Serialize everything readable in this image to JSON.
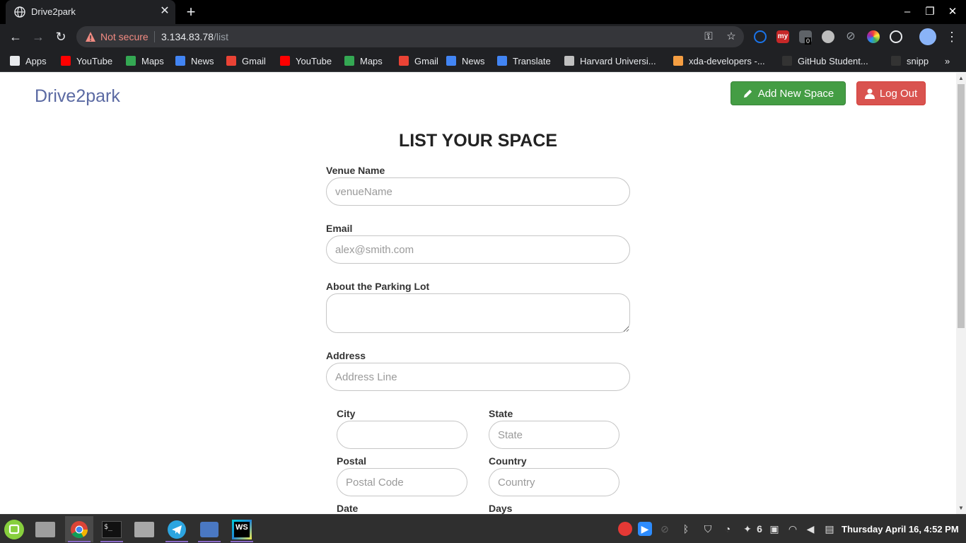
{
  "browser": {
    "tab_title": "Drive2park",
    "security_label": "Not secure",
    "url_host": "3.134.83.78",
    "url_path": "/list",
    "extension_badge": "0"
  },
  "bookmarks": [
    {
      "label": "Apps",
      "icon": "apps-grid-icon",
      "color": "#e8eaed"
    },
    {
      "label": "YouTube",
      "icon": "youtube-icon",
      "color": "#ff0000"
    },
    {
      "label": "Maps",
      "icon": "maps-icon",
      "color": "#34a853"
    },
    {
      "label": "News",
      "icon": "google-news-icon",
      "color": "#4285f4"
    },
    {
      "label": "Gmail",
      "icon": "gmail-icon",
      "color": "#ea4335"
    },
    {
      "label": "YouTube",
      "icon": "youtube-icon",
      "color": "#ff0000"
    },
    {
      "label": "Maps",
      "icon": "maps-icon",
      "color": "#34a853"
    },
    {
      "label": "Gmail",
      "icon": "gmail-icon",
      "color": "#ea4335"
    },
    {
      "label": "News",
      "icon": "google-news-icon",
      "color": "#4285f4"
    },
    {
      "label": "Translate",
      "icon": "translate-icon",
      "color": "#4285f4"
    },
    {
      "label": "Harvard Universi...",
      "icon": "edx-icon",
      "color": "#c0c0c0"
    },
    {
      "label": "xda-developers -...",
      "icon": "xda-icon",
      "color": "#f59e42"
    },
    {
      "label": "GitHub Student...",
      "icon": "github-icon",
      "color": "#333333"
    },
    {
      "label": "snipp",
      "icon": "github-icon",
      "color": "#333333"
    }
  ],
  "site": {
    "brand": "Drive2park",
    "add_button": "Add New Space",
    "logout_button": "Log Out",
    "heading": "LIST YOUR SPACE"
  },
  "form": {
    "venue_label": "Venue Name",
    "venue_placeholder": "venueName",
    "email_label": "Email",
    "email_placeholder": "alex@smith.com",
    "about_label": "About the Parking Lot",
    "about_placeholder": "",
    "address_label": "Address",
    "address_placeholder": "Address Line",
    "city_label": "City",
    "city_placeholder": "",
    "state_label": "State",
    "state_placeholder": "State",
    "postal_label": "Postal",
    "postal_placeholder": "Postal Code",
    "country_label": "Country",
    "country_placeholder": "Country",
    "date_label": "Date",
    "days_label": "Days"
  },
  "taskbar": {
    "apps": [
      "linux-mint-menu-icon",
      "file-manager-icon",
      "chrome-icon",
      "terminal-icon",
      "files-icon",
      "telegram-icon",
      "screenshot-icon",
      "webstorm-icon"
    ],
    "notification_count": "6",
    "clock": "Thursday April 16,  4:52 PM"
  },
  "colors": {
    "brand": "#5b6aa3",
    "success": "#449d44",
    "danger": "#d9534f",
    "not_secure": "#f28b82"
  }
}
